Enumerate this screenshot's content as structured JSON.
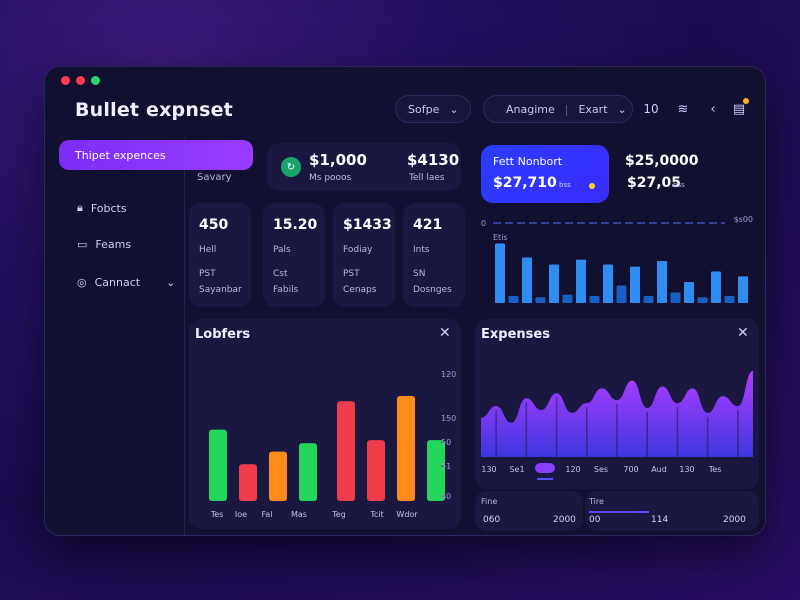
{
  "window": {
    "title": "Bullet expnset",
    "dots": [
      "#ff3b4e",
      "#ff3b4e",
      "#2bd46b"
    ]
  },
  "topbar": {
    "select1": "Sofpe",
    "select2_a": "Anagime",
    "select2_b": "Exart",
    "count": "10"
  },
  "sidebar": {
    "active": "Thipet expences",
    "sub": "Savary",
    "items": [
      {
        "label": "Fobcts",
        "icon": "lock-icon"
      },
      {
        "label": "Feams",
        "icon": "folder-icon"
      },
      {
        "label": "Cannact",
        "icon": "globe-icon"
      }
    ]
  },
  "summary": {
    "val1": "$1,000",
    "sub1": "Ms pooos",
    "val2": "$4130",
    "sub2": "Tell laes",
    "highlight_title": "Fett Nonbort",
    "highlight_value": "$27,710",
    "highlight_unit": "bss",
    "val4": "$25,0000",
    "val4b": "$27,05",
    "val4b_unit": "bss"
  },
  "stats": [
    {
      "value": "450",
      "l1": "Hell",
      "l2": "PST",
      "l3": "Sayanbar"
    },
    {
      "value": "15.20",
      "l1": "Pals",
      "l2": "Cst",
      "l3": "Fabils"
    },
    {
      "value": "$1433",
      "l1": "Fodiay",
      "l2": "PST",
      "l3": "Cenaps"
    },
    {
      "value": "421",
      "l1": "Ints",
      "l2": "SN",
      "l3": "Dosnges"
    }
  ],
  "mini_chart": {
    "label_top": "Etis",
    "left_tick": "0",
    "right_label": "$​s00",
    "values": [
      85,
      10,
      65,
      8,
      55,
      12,
      62,
      10,
      55,
      25,
      52,
      10,
      60,
      15,
      30,
      8,
      45,
      10,
      38
    ],
    "colors": [
      "#2f8cf0",
      "#1a5fc4"
    ]
  },
  "lobfers": {
    "title": "Lobfers",
    "yticks": [
      "120",
      "150",
      "50",
      "51",
      "60"
    ],
    "categories": [
      "Tes",
      "Ioe",
      "Fal",
      "Mas",
      "Teg",
      "Tcit",
      "Wdor"
    ],
    "chart_data": {
      "type": "bar",
      "categories": [
        "Tes",
        "Ioe",
        "Fal",
        "Mas",
        "Teg",
        "Tcit",
        "Wdor"
      ],
      "series": [
        {
          "values": [
            68,
            35,
            47,
            55,
            95,
            58,
            100,
            58
          ]
        }
      ],
      "bar_colors": [
        "#22d65a",
        "#ef3e4a",
        "#ff8c1a",
        "#22d65a",
        "#ef3e4a",
        "#ef3e4a",
        "#ff8c1a",
        "#22d65a"
      ]
    }
  },
  "expenses": {
    "title": "Expenses",
    "x_labels": [
      "130",
      "Se1",
      "",
      "120",
      "Ses",
      "700",
      "Aud",
      "130",
      "Tes"
    ],
    "chart_data": {
      "type": "area",
      "values": [
        40,
        52,
        35,
        60,
        48,
        65,
        45,
        55,
        70,
        58,
        78,
        50,
        72,
        55,
        70,
        45,
        62,
        52,
        88
      ]
    }
  },
  "footer": {
    "left_title": "Fine",
    "left_a": "060",
    "left_b": "2000",
    "right_title": "Tire",
    "right_a": "00",
    "right_b": "114",
    "right_c": "2000"
  }
}
